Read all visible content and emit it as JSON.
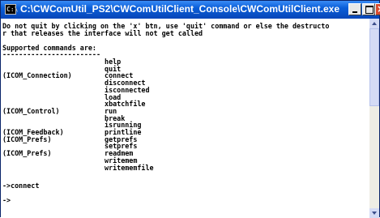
{
  "window": {
    "title": "C:\\CWComUtil_PS2\\CWComUtilClient_Console\\CWComUtilClient.exe",
    "icon": "console-icon",
    "icon_text": "C:\\",
    "close_glyph": "×"
  },
  "console": {
    "lines": [
      "Do not quit by clicking on the 'x' btn, use 'quit' command or else the destructo",
      "r that releases the interface will not get called",
      "",
      "Supported commands are:",
      "------------------------",
      "                         help",
      "                         quit",
      "(ICOM_Connection)        connect",
      "                         disconnect",
      "                         isconnected",
      "                         load",
      "                         xbatchfile",
      "(ICOM_Control)           run",
      "                         break",
      "                         isrunning",
      "(ICOM_Feedback)          printline",
      "(ICOM_Prefs)             getprefs",
      "                         setprefs",
      "(ICOM_Prefs)             readmem",
      "                         writemem",
      "                         writememfile",
      "",
      "->connect",
      "",
      "->"
    ]
  },
  "scrollbar": {
    "up_icon": "scroll-up-arrow-icon",
    "down_icon": "scroll-down-arrow-icon"
  }
}
